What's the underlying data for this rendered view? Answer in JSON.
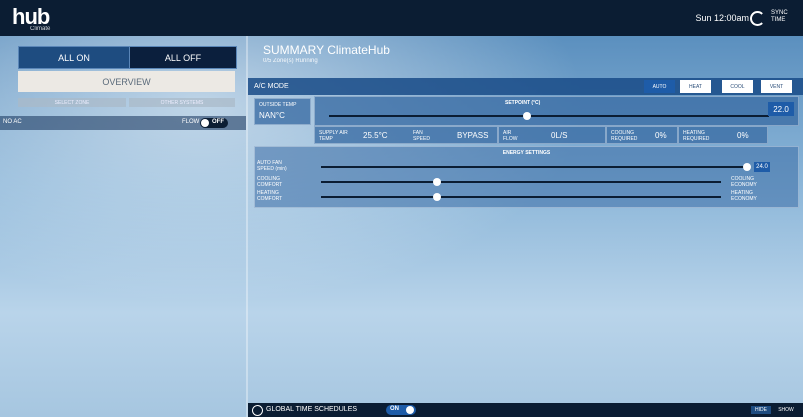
{
  "header": {
    "logo": "hub",
    "logo_sub": "Climate",
    "clock": "Sun 12:00am",
    "sync_label": "SYNC TIME"
  },
  "left": {
    "all_on": "ALL ON",
    "all_off": "ALL OFF",
    "overview": "OVERVIEW",
    "select_zone": "SELECT ZONE",
    "other_systems": "OTHER SYSTEMS",
    "zones_label": "NO AC",
    "flow_label": "FLOW",
    "flow_state": "OFF"
  },
  "summary": {
    "title": "SUMMARY ClimateHub",
    "subtitle": "0/5 Zone(s) Running"
  },
  "ac_mode": {
    "label": "A/C MODE",
    "modes": [
      "AUTO",
      "HEAT",
      "COOL",
      "VENT"
    ],
    "selected": "AUTO"
  },
  "outside_temp": {
    "label": "OUTSIDE TEMP",
    "value": "NAN°C"
  },
  "setpoint": {
    "label": "SETPOINT (°C)",
    "value": "22.0",
    "level": 0.45
  },
  "stats": [
    {
      "label": "SUPPLY AIR TEMP",
      "value": "25.5°C"
    },
    {
      "label": "FAN SPEED",
      "value": "BYPASS"
    },
    {
      "label": "AIR FLOW",
      "value": "0L/S"
    },
    {
      "label": "COOLING REQUIRED",
      "value": "0%"
    },
    {
      "label": "HEATING REQUIRED",
      "value": "0%"
    }
  ],
  "energy": {
    "title": "ENERGY SETTINGS",
    "sliders": [
      {
        "left": "AUTO FAN SPEED (min)",
        "right": "",
        "value": "24.0",
        "level": 1.0
      },
      {
        "left": "COOLING COMFORT",
        "right": "COOLING ECONOMY",
        "level": 0.29
      },
      {
        "left": "HEATING COMFORT",
        "right": "HEATING ECONOMY",
        "level": 0.29
      }
    ]
  },
  "bottom": {
    "schedules_label": "GLOBAL TIME SCHEDULES",
    "schedules_state": "ON",
    "hide": "HIDE",
    "show": "SHOW"
  }
}
